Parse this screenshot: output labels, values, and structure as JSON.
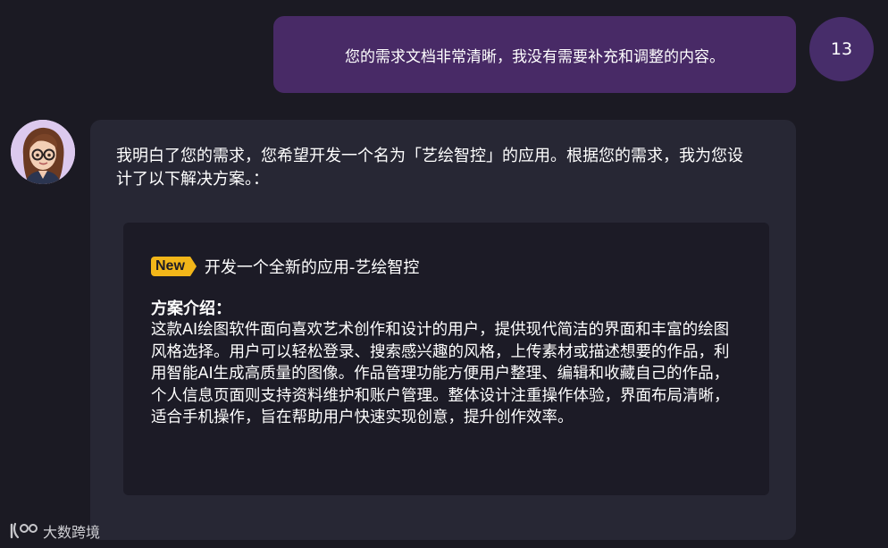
{
  "user_message": {
    "text": "您的需求文档非常清晰，我没有需要补充和调整的内容。",
    "avatar_label": "13"
  },
  "assistant_message": {
    "intro_text": "我明白了您的需求，您希望开发一个名为「艺绘智控」的应用。根据您的需求，我为您设计了以下解决方案。：",
    "plan": {
      "badge": "New",
      "title": "开发一个全新的应用-艺绘智控",
      "section_heading": "方案介绍：",
      "section_body": "这款AI绘图软件面向喜欢艺术创作和设计的用户，提供现代简洁的界面和丰富的绘图风格选择。用户可以轻松登录、搜索感兴趣的风格，上传素材或描述想要的作品，利用智能AI生成高质量的图像。作品管理功能方便用户整理、编辑和收藏自己的作品，个人信息页面则支持资料维护和账户管理。整体设计注重操作体验，界面布局清晰，适合手机操作，旨在帮助用户快速实现创意，提升创作效率。"
    }
  },
  "watermark": {
    "text": "大数跨境"
  },
  "colors": {
    "background": "#1b1a23",
    "user_bubble": "#482a66",
    "assistant_bubble": "#272734",
    "plan_card": "#1c1b26",
    "badge": "#f2b619"
  }
}
